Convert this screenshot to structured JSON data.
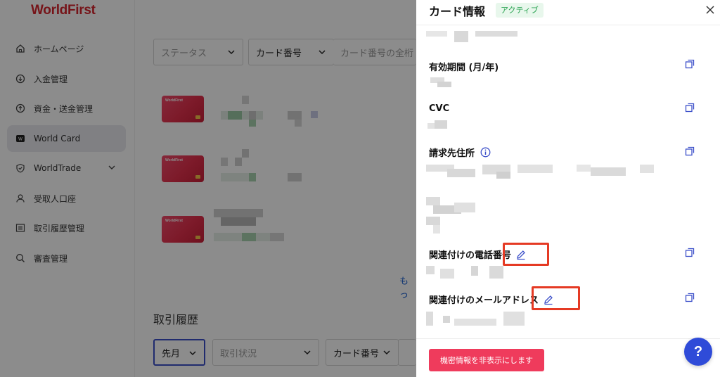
{
  "app": {
    "brand": "WorldFirst"
  },
  "sidebar": {
    "items": [
      {
        "label": "ホームページ",
        "icon": "home-icon"
      },
      {
        "label": "入金管理",
        "icon": "deposit-icon"
      },
      {
        "label": "資金・送金管理",
        "icon": "transfer-icon"
      },
      {
        "label": "World Card",
        "icon": "card-icon",
        "active": true
      },
      {
        "label": "WorldTrade",
        "icon": "shield-icon",
        "has_submenu": true
      },
      {
        "label": "受取人口座",
        "icon": "user-icon"
      },
      {
        "label": "取引履歴管理",
        "icon": "list-icon"
      },
      {
        "label": "審査管理",
        "icon": "search-icon"
      }
    ]
  },
  "main": {
    "filters": {
      "status_placeholder": "ステータス",
      "card_select": "カード番号",
      "card_search_placeholder": "カード番号の全桁"
    },
    "more_link": "もっ",
    "history": {
      "title": "取引履歴",
      "period": "先月",
      "status_placeholder": "取引状況",
      "card_select": "カード番号"
    }
  },
  "drawer": {
    "title": "カード情報",
    "status": "アクティブ",
    "fields": {
      "expiry_label": "有効期間 (月/年)",
      "cvc_label": "CVC",
      "billing_label": "請求先住所",
      "phone_label": "関連付けの電話番号",
      "email_label": "関連付けのメールアドレス"
    },
    "hide_button": "機密情報を非表示にします"
  },
  "help": {
    "label": "?"
  },
  "colors": {
    "brand": "#d8262e",
    "accent_button": "#ef3b5c",
    "badge_bg": "#e8f7ec",
    "badge_text": "#28a350",
    "help_button": "#2f4bd8",
    "highlight": "#e53a24"
  }
}
